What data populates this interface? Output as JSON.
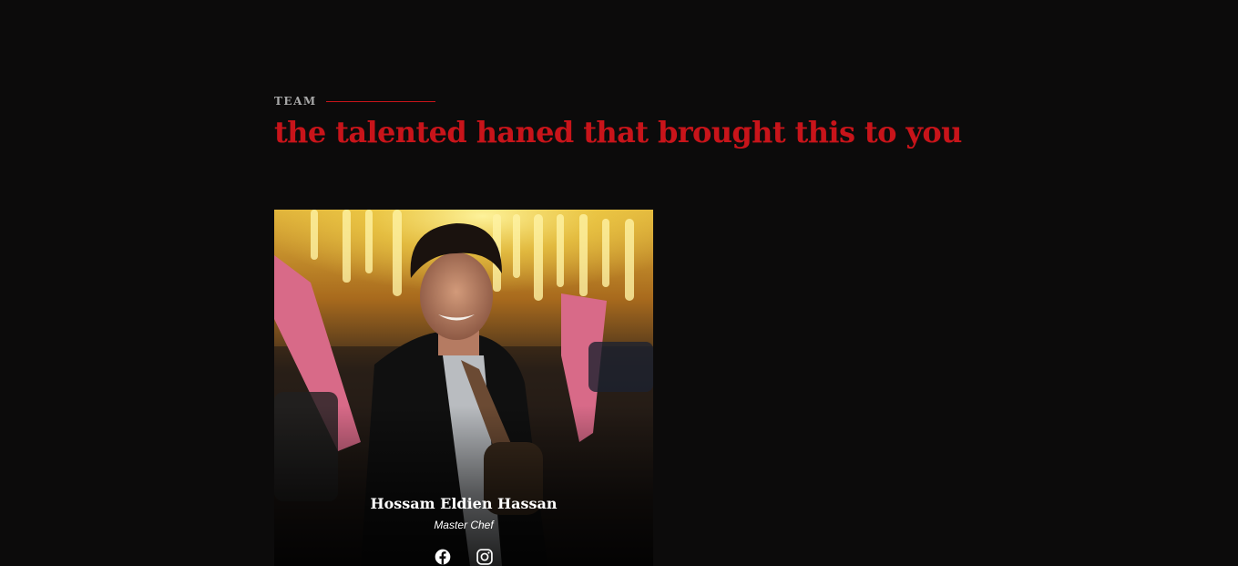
{
  "section": {
    "label": "TEAM",
    "title": "the talented haned that brought this to you",
    "accent_color": "#c8141a"
  },
  "team": [
    {
      "name": "Hossam Eldien Hassan",
      "role": "Master Chef",
      "photo_icon": "chef-portrait-photo",
      "socials": [
        {
          "network": "facebook",
          "icon": "facebook-icon"
        },
        {
          "network": "instagram",
          "icon": "instagram-icon"
        }
      ]
    }
  ]
}
